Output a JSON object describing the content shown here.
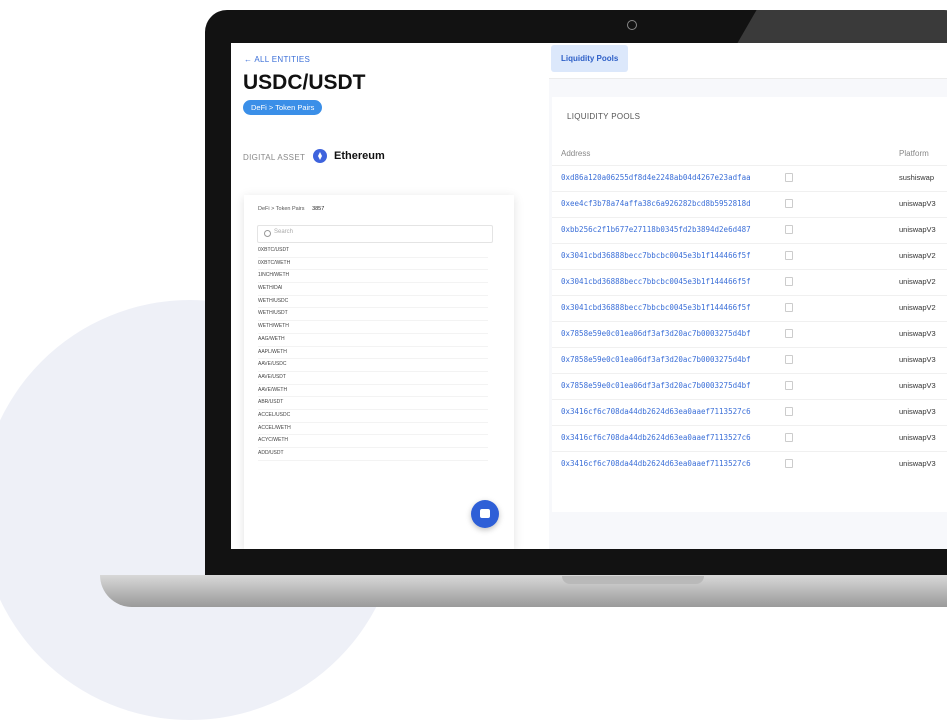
{
  "sidebar": {
    "back_link": "← ALL ENTITIES",
    "title": "USDC/USDT",
    "breadcrumb_pill": "DeFi > Token Pairs",
    "asset_label": "DIGITAL ASSET",
    "asset_name": "Ethereum",
    "panel": {
      "heading": "DeFi > Token Pairs",
      "count": "3857",
      "search_placeholder": "Search",
      "items": [
        "0XBTC/USDT",
        "0XBTC/WETH",
        "1INCH/WETH",
        "WETH/DAI",
        "WETH/USDC",
        "WETH/USDT",
        "WETH/WETH",
        "AAG/WETH",
        "AAPL/WETH",
        "AAVE/USDC",
        "AAVE/USDT",
        "AAVE/WETH",
        "ABR/USDT",
        "ACCEL/USDC",
        "ACCEL/WETH",
        "ACYC/WETH",
        "ADD/USDT"
      ]
    }
  },
  "main": {
    "tab_label": "Liquidity Pools",
    "card_title": "LIQUIDITY POOLS",
    "columns": [
      "Address",
      "Platform"
    ],
    "rows": [
      {
        "address": "0xd86a120a06255df8d4e2248ab04d4267e23adfaa",
        "platform": "sushiswap"
      },
      {
        "address": "0xee4cf3b78a74affa38c6a926282bcd8b5952818d",
        "platform": "uniswapV3"
      },
      {
        "address": "0xbb256c2f1b677e27118b0345fd2b3894d2e6d487",
        "platform": "uniswapV3"
      },
      {
        "address": "0x3041cbd36888becc7bbcbc0045e3b1f144466f5f",
        "platform": "uniswapV2"
      },
      {
        "address": "0x3041cbd36888becc7bbcbc0045e3b1f144466f5f",
        "platform": "uniswapV2"
      },
      {
        "address": "0x3041cbd36888becc7bbcbc0045e3b1f144466f5f",
        "platform": "uniswapV2"
      },
      {
        "address": "0x7858e59e0c01ea06df3af3d20ac7b0003275d4bf",
        "platform": "uniswapV3"
      },
      {
        "address": "0x7858e59e0c01ea06df3af3d20ac7b0003275d4bf",
        "platform": "uniswapV3"
      },
      {
        "address": "0x7858e59e0c01ea06df3af3d20ac7b0003275d4bf",
        "platform": "uniswapV3"
      },
      {
        "address": "0x3416cf6c708da44db2624d63ea0aaef7113527c6",
        "platform": "uniswapV3"
      },
      {
        "address": "0x3416cf6c708da44db2624d63ea0aaef7113527c6",
        "platform": "uniswapV3"
      },
      {
        "address": "0x3416cf6c708da44db2624d63ea0aaef7113527c6",
        "platform": "uniswapV3"
      }
    ]
  },
  "colors": {
    "accent": "#3b6fd8",
    "pill": "#3b8fe8",
    "tab_bg": "#dce8fb"
  }
}
